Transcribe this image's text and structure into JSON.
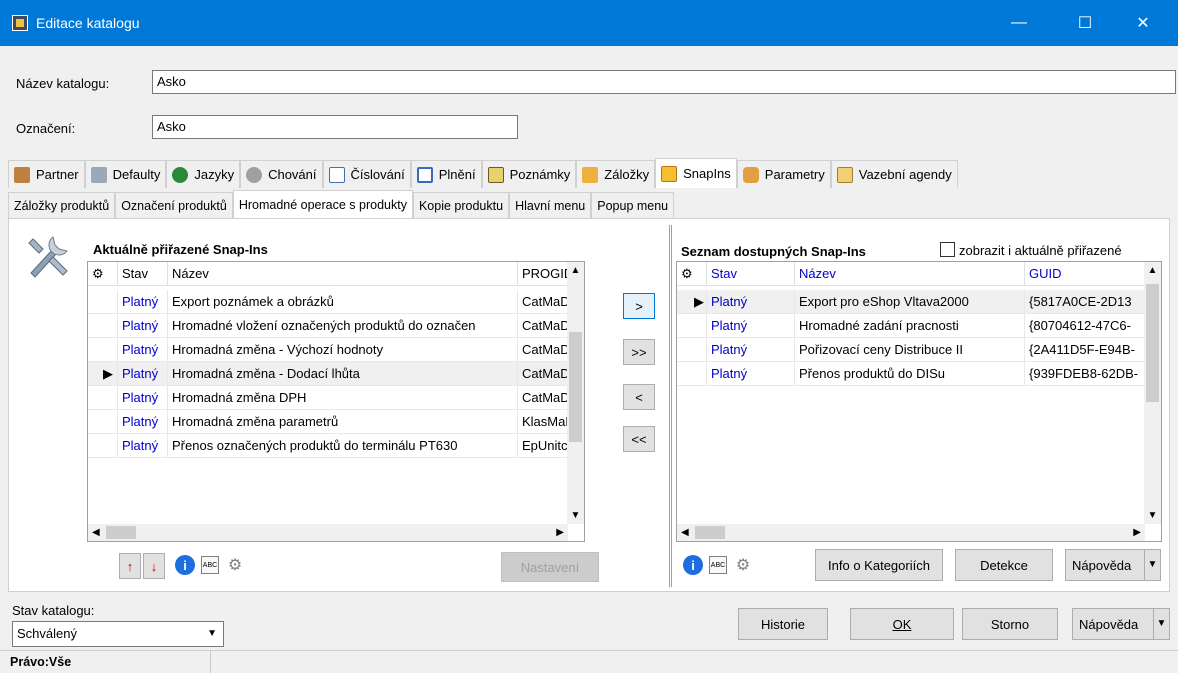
{
  "window": {
    "title": "Editace katalogu",
    "minimize": "—",
    "maximize": "☐",
    "close": "✕"
  },
  "form": {
    "name_label": "Název katalogu:",
    "name_value": "Asko",
    "code_label": "Označení:",
    "code_value": "Asko"
  },
  "tabs": [
    {
      "label": "Partner",
      "icon": "partner-icon"
    },
    {
      "label": "Defaulty",
      "icon": "tools-icon"
    },
    {
      "label": "Jazyky",
      "icon": "globe-icon"
    },
    {
      "label": "Chování",
      "icon": "gears-icon"
    },
    {
      "label": "Číslování",
      "icon": "numbering-icon"
    },
    {
      "label": "Plnění",
      "icon": "table-icon"
    },
    {
      "label": "Poznámky",
      "icon": "notes-icon"
    },
    {
      "label": "Záložky",
      "icon": "bookmarks-icon"
    },
    {
      "label": "SnapIns",
      "icon": "snapins-icon"
    },
    {
      "label": "Parametry",
      "icon": "parameters-icon"
    },
    {
      "label": "Vazební agendy",
      "icon": "linked-agendas-icon"
    }
  ],
  "subtabs": [
    "Záložky produktů",
    "Označení produktů",
    "Hromadné operace s produkty",
    "Kopie produktu",
    "Hlavní menu",
    "Popup menu"
  ],
  "left": {
    "title": "Aktuálně přiřazené Snap-Ins",
    "columns": [
      "Stav",
      "Název",
      "PROGID"
    ],
    "rows": [
      {
        "stav": "Platný",
        "nazev": "Export poznámek a obrázků",
        "progid": "CatMaDr"
      },
      {
        "stav": "Platný",
        "nazev": "Hromadné vložení označených produktů do označen",
        "progid": "CatMaDr"
      },
      {
        "stav": "Platný",
        "nazev": "Hromadná změna - Výchozí hodnoty",
        "progid": "CatMaDr"
      },
      {
        "stav": "Platný",
        "nazev": "Hromadná změna - Dodací lhůta",
        "progid": "CatMaDr"
      },
      {
        "stav": "Platný",
        "nazev": "Hromadná změna DPH",
        "progid": "CatMaDr"
      },
      {
        "stav": "Platný",
        "nazev": "Hromadná změna parametrů",
        "progid": "KlasMaDı"
      },
      {
        "stav": "Platný",
        "nazev": "Přenos označených produktů do terminálu PT630",
        "progid": "EpUnitch"
      }
    ],
    "settings_button": "Nastavení"
  },
  "transfer": {
    "add": ">",
    "add_all": ">>",
    "remove": "<",
    "remove_all": "<<"
  },
  "right": {
    "title": "Seznam dostupných Snap-Ins",
    "checkbox_label": "zobrazit i aktuálně přiřazené",
    "columns": [
      "Stav",
      "Název",
      "GUID"
    ],
    "rows": [
      {
        "stav": "Platný",
        "nazev": "Export pro eShop Vltava2000",
        "guid": "{5817A0CE-2D13"
      },
      {
        "stav": "Platný",
        "nazev": "Hromadné zadání pracnosti",
        "guid": "{80704612-47C6-"
      },
      {
        "stav": "Platný",
        "nazev": "Pořizovací ceny Distribuce II",
        "guid": "{2A411D5F-E94B-"
      },
      {
        "stav": "Platný",
        "nazev": "Přenos produktů do DISu",
        "guid": "{939FDEB8-62DB-"
      }
    ],
    "info_button": "Info o Kategoriích",
    "detect_button": "Detekce",
    "help_button": "Nápověda"
  },
  "bottom": {
    "status_label": "Stav katalogu:",
    "status_value": "Schválený",
    "history_button": "Historie",
    "ok_button": "OK",
    "cancel_button": "Storno",
    "help_button": "Nápověda"
  },
  "statusbar": {
    "rights": "Právo:Vše"
  },
  "colors": {
    "titlebar": "#0078d7",
    "link_blue": "#0000cc"
  }
}
